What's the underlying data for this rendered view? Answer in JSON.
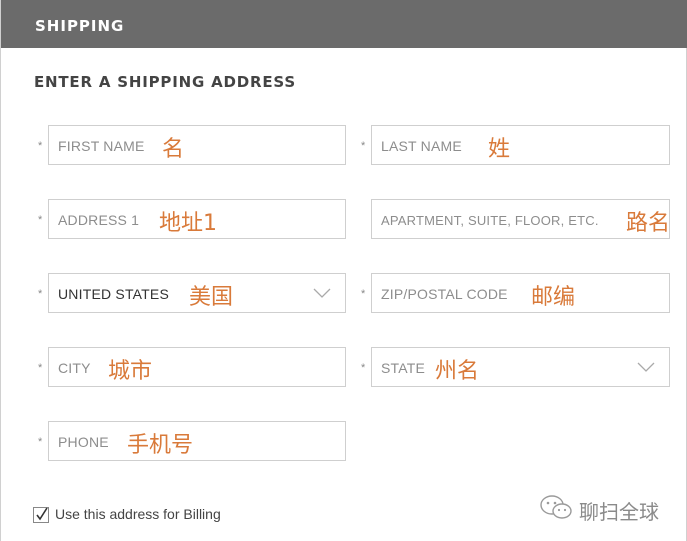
{
  "header": {
    "title": "SHIPPING"
  },
  "section": {
    "title": "ENTER A SHIPPING ADDRESS"
  },
  "required_marker": "*",
  "fields": {
    "first_name": {
      "placeholder": "FIRST NAME",
      "annotation": "名"
    },
    "last_name": {
      "placeholder": "LAST NAME",
      "annotation": "姓"
    },
    "address1": {
      "placeholder": "ADDRESS 1",
      "annotation": "地址1"
    },
    "address2": {
      "placeholder": "APARTMENT, SUITE, FLOOR, ETC.",
      "annotation": "路名"
    },
    "country": {
      "value": "UNITED STATES",
      "annotation": "美国"
    },
    "zip": {
      "placeholder": "ZIP/POSTAL CODE",
      "annotation": "邮编"
    },
    "city": {
      "placeholder": "CITY",
      "annotation": "城市"
    },
    "state": {
      "placeholder": "STATE",
      "annotation": "州名"
    },
    "phone": {
      "placeholder": "PHONE",
      "annotation": "手机号"
    }
  },
  "billing": {
    "label": "Use this address for Billing",
    "checked": true
  },
  "watermark": {
    "text": "聊扫全球",
    "icon": "wechat-icon"
  },
  "colors": {
    "header_bg": "#6b6b6b",
    "annotation": "#d97a3a",
    "border": "#cfcfcf"
  }
}
